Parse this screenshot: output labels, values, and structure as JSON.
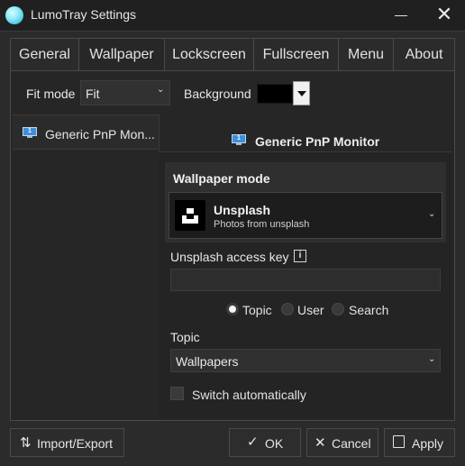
{
  "window": {
    "title": "LumoTray Settings"
  },
  "tabs": [
    {
      "label": "General"
    },
    {
      "label": "Wallpaper",
      "active": true
    },
    {
      "label": "Lockscreen"
    },
    {
      "label": "Fullscreen"
    },
    {
      "label": "Menu"
    },
    {
      "label": "About"
    }
  ],
  "fit_mode": {
    "label": "Fit mode",
    "value": "Fit"
  },
  "background": {
    "label": "Background",
    "color": "#000000"
  },
  "monitor_list": {
    "items": [
      {
        "label": "Generic PnP Mon...",
        "number": "1"
      }
    ]
  },
  "monitor_heading": {
    "label": "Generic PnP Monitor",
    "number": "1"
  },
  "wallpaper_mode": {
    "heading": "Wallpaper mode",
    "selected_title": "Unsplash",
    "selected_subtitle": "Photos from unsplash"
  },
  "access_key": {
    "label": "Unsplash access key",
    "info_icon": "i",
    "value": ""
  },
  "source_radios": [
    {
      "label": "Topic",
      "checked": true
    },
    {
      "label": "User",
      "checked": false
    },
    {
      "label": "Search",
      "checked": false
    }
  ],
  "topic": {
    "label": "Topic",
    "value": "Wallpapers"
  },
  "auto_switch": {
    "label": "Switch automatically",
    "checked": false
  },
  "buttons": {
    "import_export": "Import/Export",
    "ok": "OK",
    "cancel": "Cancel",
    "apply": "Apply"
  },
  "icons": {
    "app_logo": "app-logo-icon",
    "monitor": "monitor-icon",
    "unsplash": "unsplash-logo-icon",
    "import_export": "up-down-arrows-icon",
    "ok": "check-icon",
    "cancel": "x-icon",
    "apply": "floppy-disk-icon"
  },
  "colors": {
    "accent_logo": "#45c7e6",
    "window_bg": "#2b2b2b"
  }
}
